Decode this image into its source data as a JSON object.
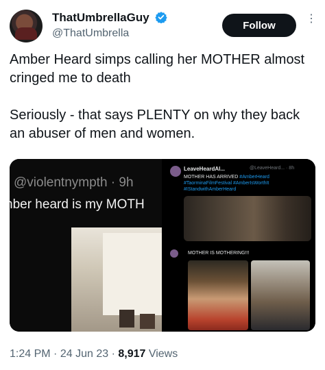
{
  "author": {
    "display_name": "ThatUmbrellaGuy",
    "handle": "@ThatUmbrella",
    "verified": true
  },
  "follow_label": "Follow",
  "tweet": {
    "paragraphs": [
      "Amber Heard simps calling her MOTHER almost cringed me to death",
      "Seriously - that says PLENTY on why they back an abuser of men and women."
    ]
  },
  "media": {
    "left": {
      "handle_line": "@violentnympth · 9h",
      "text_line": "nber heard is my MOTH"
    },
    "top_right": {
      "name": "LeaveHeardAl...",
      "meta": "@LeaveHeard... · 8h",
      "line1_text": "MOTHER HAS ARRIVED ",
      "line1_tag": "#AmberHeard",
      "line2": "#TaorminaFilmFestival #AmberIsWorthIt",
      "line3": "#IStandwithAmberHeard"
    },
    "bottom_right": {
      "text": "MOTHER IS MOTHERING!!!"
    }
  },
  "footer": {
    "time": "1:24 PM",
    "date": "24 Jun 23",
    "views": "8,917",
    "views_label": "Views"
  },
  "colors": {
    "follow_bg": "#0f1419",
    "verified": "#1d9bf0",
    "muted": "#536471"
  }
}
